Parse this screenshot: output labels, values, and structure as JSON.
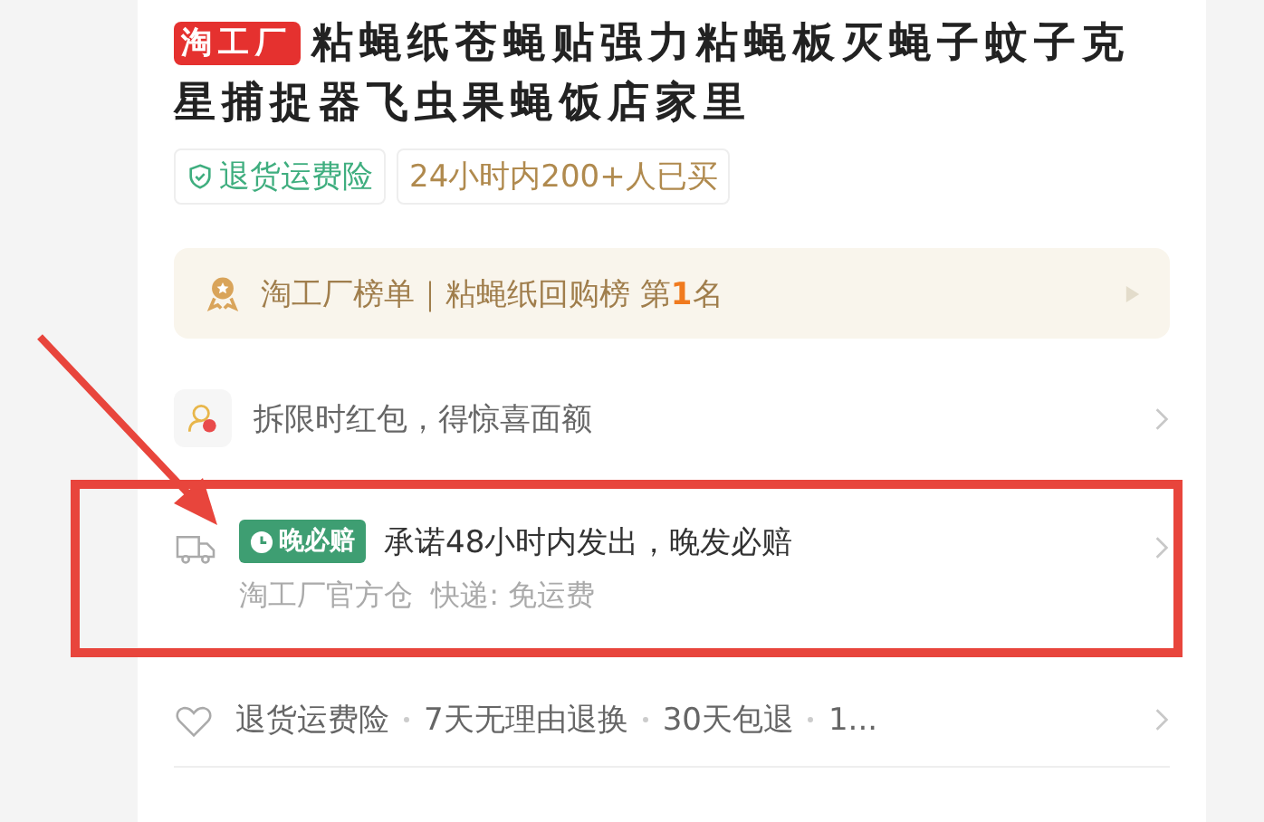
{
  "product": {
    "badge": "淘工厂",
    "title": "粘蝇纸苍蝇贴强力粘蝇板灭蝇子蚊子克星捕捉器飞虫果蝇饭店家里"
  },
  "tags": [
    {
      "kind": "insurance",
      "label": "退货运费险"
    },
    {
      "kind": "sales",
      "label": "24小时内200+人已买"
    }
  ],
  "ranking": {
    "text": "淘工厂榜单｜粘蝇纸回购榜 第**1**名"
  },
  "rows": [
    {
      "kind": "coupon",
      "text": "拆限时红包，得惊喜面额"
    },
    {
      "kind": "delivery",
      "badge": "晚必赔",
      "text": "承诺48小时内发出，晚发必赔",
      "subtext": "淘工厂官方仓  快递: 免运费",
      "highlighted": true
    },
    {
      "kind": "service",
      "items": [
        "退货运费险",
        "7天无理由退换",
        "30天包退",
        "1..."
      ]
    }
  ]
}
